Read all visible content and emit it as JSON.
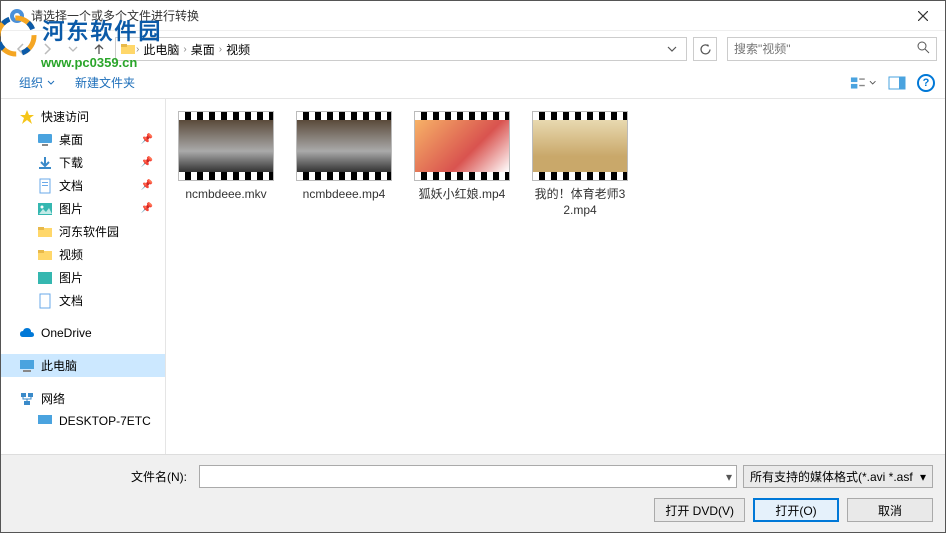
{
  "window": {
    "title": "请选择一个或多个文件进行转换"
  },
  "nav": {
    "breadcrumb": [
      "此电脑",
      "桌面",
      "视频"
    ],
    "search_placeholder": "搜索\"视频\""
  },
  "toolbar": {
    "organize": "组织",
    "new_folder": "新建文件夹"
  },
  "sidebar": {
    "quick": "快速访问",
    "desktop": "桌面",
    "downloads": "下载",
    "documents": "文档",
    "pictures": "图片",
    "hedong": "河东软件园",
    "video": "视频",
    "pictures2": "图片",
    "documents2": "文档",
    "onedrive": "OneDrive",
    "thispc": "此电脑",
    "network": "网络",
    "desktop_node": "DESKTOP-7ETC"
  },
  "files": [
    {
      "name": "ncmbdeee.mkv",
      "kind": "car"
    },
    {
      "name": "ncmbdeee.mp4",
      "kind": "car"
    },
    {
      "name": "狐妖小红娘.mp4",
      "kind": "anime"
    },
    {
      "name": "我的！体育老师32.mp4",
      "kind": "sport"
    }
  ],
  "bottom": {
    "filename_label": "文件名(N):",
    "filter": "所有支持的媒体格式(*.avi *.asf",
    "open_dvd": "打开 DVD(V)",
    "open": "打开(O)",
    "cancel": "取消"
  },
  "watermark": {
    "text": "河东软件园",
    "url": "www.pc0359.cn"
  }
}
